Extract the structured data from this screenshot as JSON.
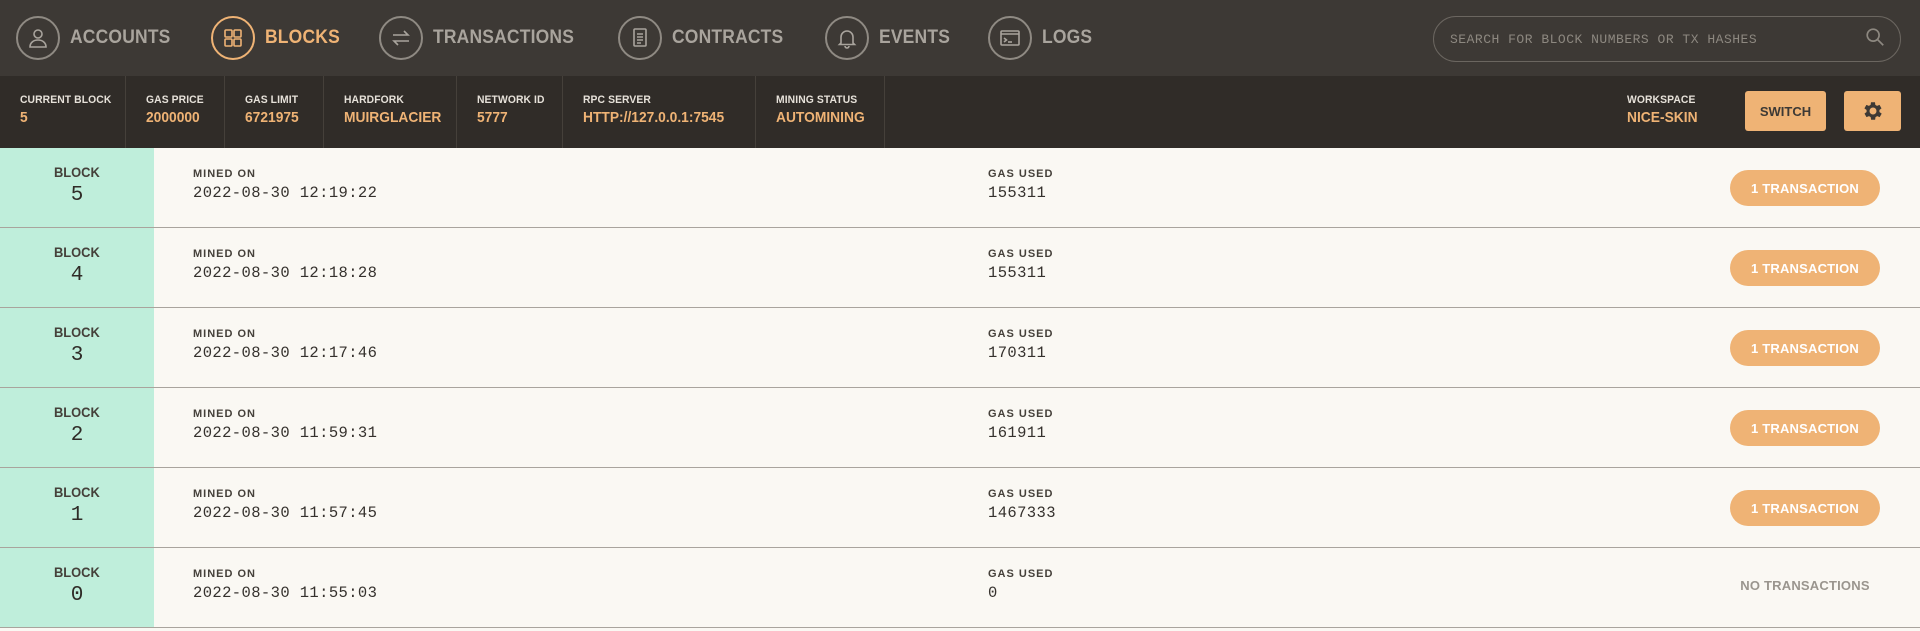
{
  "nav": {
    "items": [
      {
        "label": "ACCOUNTS",
        "icon": "user-icon",
        "active": false
      },
      {
        "label": "BLOCKS",
        "icon": "grid-icon",
        "active": true
      },
      {
        "label": "TRANSACTIONS",
        "icon": "arrows-swap-icon",
        "active": false
      },
      {
        "label": "CONTRACTS",
        "icon": "document-icon",
        "active": false
      },
      {
        "label": "EVENTS",
        "icon": "bell-icon",
        "active": false
      },
      {
        "label": "LOGS",
        "icon": "terminal-icon",
        "active": false
      }
    ],
    "search_placeholder": "SEARCH FOR BLOCK NUMBERS OR TX HASHES",
    "accent_color": "#efb375"
  },
  "status": {
    "current_block": {
      "label": "CURRENT BLOCK",
      "value": "5"
    },
    "gas_price": {
      "label": "GAS PRICE",
      "value": "2000000"
    },
    "gas_limit": {
      "label": "GAS LIMIT",
      "value": "6721975"
    },
    "hardfork": {
      "label": "HARDFORK",
      "value": "MUIRGLACIER"
    },
    "network_id": {
      "label": "NETWORK ID",
      "value": "5777"
    },
    "rpc_server": {
      "label": "RPC SERVER",
      "value": "HTTP://127.0.0.1:7545"
    },
    "mining_status": {
      "label": "MINING STATUS",
      "value": "AUTOMINING"
    },
    "workspace": {
      "label": "WORKSPACE",
      "value": "NICE-SKIN"
    },
    "switch_label": "SWITCH"
  },
  "blocks": {
    "block_word": "BLOCK",
    "mined_label": "MINED ON",
    "gas_label": "GAS USED",
    "rows": [
      {
        "number": "5",
        "mined_on": "2022-08-30 12:19:22",
        "gas_used": "155311",
        "tx": "1 TRANSACTION"
      },
      {
        "number": "4",
        "mined_on": "2022-08-30 12:18:28",
        "gas_used": "155311",
        "tx": "1 TRANSACTION"
      },
      {
        "number": "3",
        "mined_on": "2022-08-30 12:17:46",
        "gas_used": "170311",
        "tx": "1 TRANSACTION"
      },
      {
        "number": "2",
        "mined_on": "2022-08-30 11:59:31",
        "gas_used": "161911",
        "tx": "1 TRANSACTION"
      },
      {
        "number": "1",
        "mined_on": "2022-08-30 11:57:45",
        "gas_used": "1467333",
        "tx": "1 TRANSACTION"
      },
      {
        "number": "0",
        "mined_on": "2022-08-30 11:55:03",
        "gas_used": "0",
        "tx": "NO TRANSACTIONS"
      }
    ]
  }
}
